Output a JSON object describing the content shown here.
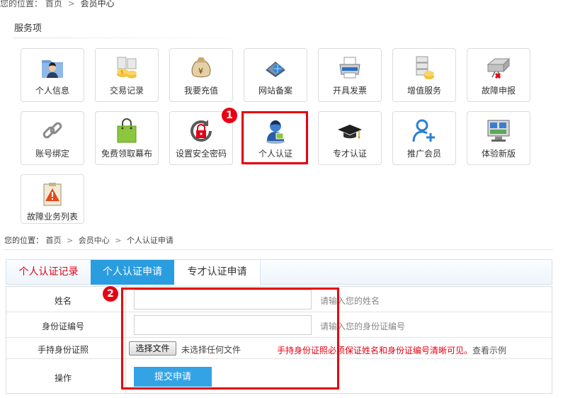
{
  "breadcrumb_top": {
    "prefix": "您的位置：",
    "items": [
      "首页",
      "会员中心"
    ],
    "separator": ">"
  },
  "services": {
    "title": "服务项",
    "tiles": [
      {
        "label": "个人信息",
        "icon": "user-folder-icon"
      },
      {
        "label": "交易记录",
        "icon": "coins-icon"
      },
      {
        "label": "我要充值",
        "icon": "money-bag-icon"
      },
      {
        "label": "网站备案",
        "icon": "website-icon"
      },
      {
        "label": "开具发票",
        "icon": "printer-icon"
      },
      {
        "label": "增值服务",
        "icon": "server-coins-icon"
      },
      {
        "label": "故障申报",
        "icon": "broken-device-icon"
      },
      {
        "label": "账号绑定",
        "icon": "link-icon"
      },
      {
        "label": "免费领取幕布",
        "icon": "shopping-bag-icon"
      },
      {
        "label": "设置安全密码",
        "icon": "refresh-lock-icon"
      },
      {
        "label": "个人认证",
        "icon": "verified-user-icon"
      },
      {
        "label": "专才认证",
        "icon": "graduation-cap-icon"
      },
      {
        "label": "推广会员",
        "icon": "add-user-icon"
      },
      {
        "label": "体验新版",
        "icon": "monitor-icon"
      },
      {
        "label": "故障业务列表",
        "icon": "warning-clipboard-icon"
      }
    ]
  },
  "badges": [
    "1",
    "2"
  ],
  "breadcrumb_sub": {
    "prefix": "您的位置：",
    "items": [
      "首页",
      "会员中心",
      "个人认证申请"
    ],
    "separator": ">"
  },
  "tabs": [
    {
      "label": "个人认证记录"
    },
    {
      "label": "个人认证申请"
    },
    {
      "label": "专才认证申请"
    }
  ],
  "form": {
    "name": {
      "label": "姓名",
      "value": "",
      "hint": "请输入您的姓名"
    },
    "id_number": {
      "label": "身份证编号",
      "value": "",
      "hint": "请输入您的身份证编号"
    },
    "id_photo": {
      "label": "手持身份证照",
      "button": "选择文件",
      "filename": "未选择任何文件",
      "warning": "手持身份证照必须保证姓名和身份证编号清晰可见。",
      "example_link": "查看示例"
    },
    "action": {
      "label": "操作",
      "submit": "提交申请"
    }
  },
  "colors": {
    "accent": "#2a9de0",
    "highlight": "#e60012",
    "warning": "#e60012"
  }
}
